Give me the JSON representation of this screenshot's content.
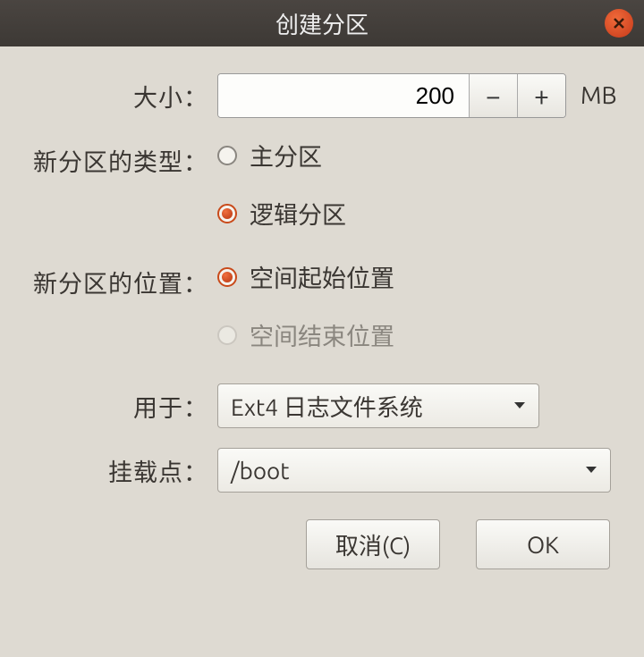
{
  "title": "创建分区",
  "size": {
    "label": "大小：",
    "value": "200",
    "unit": "MB"
  },
  "type": {
    "label": "新分区的类型：",
    "options": {
      "primary": "主分区",
      "logical": "逻辑分区"
    },
    "selected": "logical"
  },
  "location": {
    "label": "新分区的位置：",
    "options": {
      "beginning": "空间起始位置",
      "end": "空间结束位置"
    },
    "selected": "beginning",
    "end_disabled": true
  },
  "usedfor": {
    "label": "用于：",
    "value": "Ext4 日志文件系统"
  },
  "mountpoint": {
    "label": "挂载点：",
    "value": "/boot"
  },
  "buttons": {
    "cancel": "取消(C)",
    "ok": "OK"
  }
}
